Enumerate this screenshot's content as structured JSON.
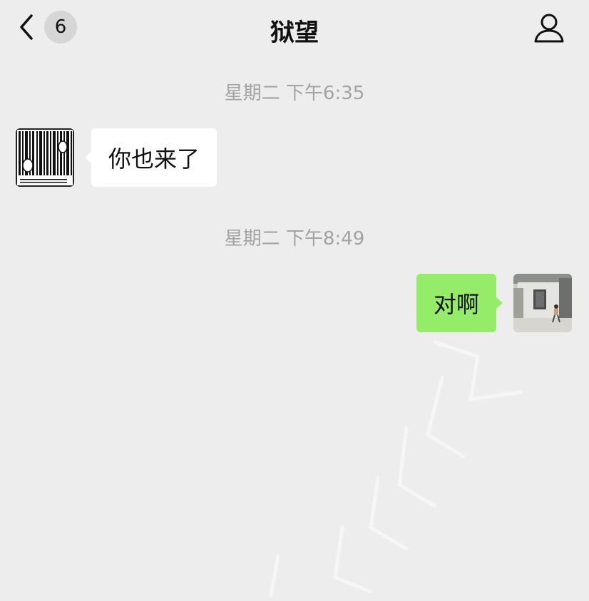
{
  "header": {
    "unread_count": "6",
    "title": "狱望"
  },
  "messages": [
    {
      "timestamp": "星期二 下午6:35",
      "direction": "incoming",
      "text": "你也来了",
      "avatar": "barcode-prison-avatar"
    },
    {
      "timestamp": "星期二 下午8:49",
      "direction": "outgoing",
      "text": "对啊",
      "avatar": "building-photo-avatar"
    }
  ],
  "colors": {
    "background": "#ededed",
    "incoming_bubble": "#ffffff",
    "outgoing_bubble": "#95ec69",
    "timestamp_text": "#a3a3a3",
    "badge_bg": "#d6d6d6"
  }
}
